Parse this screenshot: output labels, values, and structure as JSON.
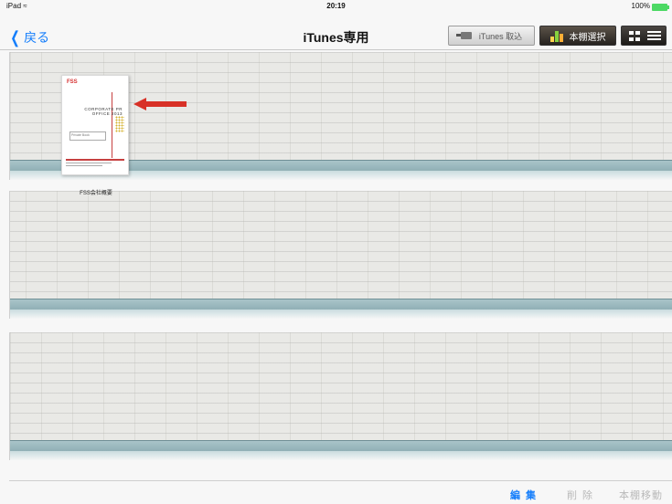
{
  "status_bar": {
    "device": "iPad ≈",
    "time": "20:19",
    "battery": "100%"
  },
  "nav": {
    "back_label": "戻る",
    "title": "iTunes専用",
    "itunes_import_label": "iTunes 取込",
    "shelf_select_label": "本棚選択"
  },
  "book": {
    "logo": "FSS",
    "cover_title": "CORPORATE PR OFFICE 2013",
    "box_text": "Private Book",
    "label": "FSS会社概要"
  },
  "toolbar": {
    "edit_label": "編集",
    "delete_label": "削除",
    "move_label": "本棚移動"
  },
  "colors": {
    "link": "#157efb",
    "arrow": "#d83127",
    "ledge": "#8eaeb4"
  },
  "icons": {
    "back": "chevron-left-icon",
    "itunes": "itunes-import-icon",
    "shelf": "bookshelf-icon",
    "grid": "grid-view-icon",
    "list": "list-view-icon"
  }
}
